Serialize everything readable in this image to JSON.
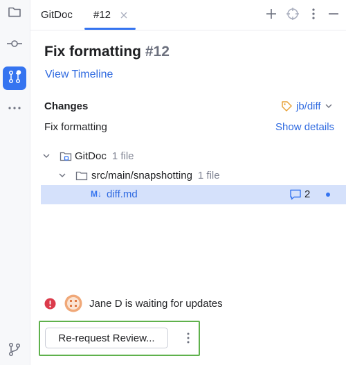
{
  "tabs": [
    {
      "label": "GitDoc"
    },
    {
      "label": "#12"
    }
  ],
  "pr": {
    "title": "Fix formatting",
    "number": "#12",
    "view_timeline": "View Timeline"
  },
  "changes": {
    "heading": "Changes",
    "branch": "jb/diff",
    "commit_message": "Fix formatting",
    "show_details": "Show details"
  },
  "tree": {
    "root": {
      "name": "GitDoc",
      "count": "1 file"
    },
    "folder": {
      "name": "src/main/snapshotting",
      "count": "1 file"
    },
    "file": {
      "badge": "M↓",
      "name": "diff.md",
      "comments": "2"
    }
  },
  "status": {
    "message": "Jane D is waiting for updates"
  },
  "actions": {
    "rerequest_label": "Re-request Review..."
  },
  "colors": {
    "accent": "#3574f0",
    "link": "#2f6ae0",
    "selection": "#d5e1fb",
    "error": "#db3b4b",
    "highlight_border": "#5fb14c"
  }
}
